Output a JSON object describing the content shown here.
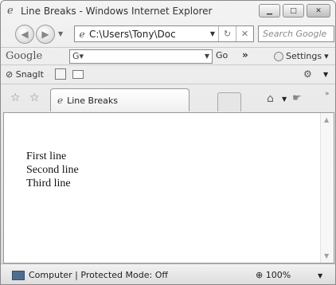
{
  "window": {
    "title": "Line Breaks - Windows Internet Explorer",
    "controls": {
      "minimize": "▁",
      "maximize": "□",
      "close": "✕"
    }
  },
  "nav": {
    "address": "C:\\Users\\Tony\\Doc",
    "search_placeholder": "Search Google"
  },
  "google_toolbar": {
    "logo": "Google",
    "combo_value": "G",
    "go_label": "Go",
    "more": "»",
    "settings_label": "Settings"
  },
  "snagit_toolbar": {
    "label": "SnagIt"
  },
  "tabs": [
    {
      "label": "Line Breaks"
    }
  ],
  "page": {
    "lines": [
      "First line",
      "Second line",
      "Third line"
    ]
  },
  "status": {
    "zone_text": "Computer | Protected Mode: Off",
    "zoom": "100%"
  },
  "icons": {
    "ie": "ie-logo-icon",
    "back": "back-arrow-icon",
    "forward": "forward-arrow-icon",
    "refresh": "refresh-icon",
    "stop": "stop-icon",
    "favorites": "favorites-star-icon",
    "add_favorite": "add-favorite-icon",
    "home": "home-icon",
    "feeds": "feed-icon",
    "computer": "computer-icon",
    "zoom": "zoom-icon"
  }
}
